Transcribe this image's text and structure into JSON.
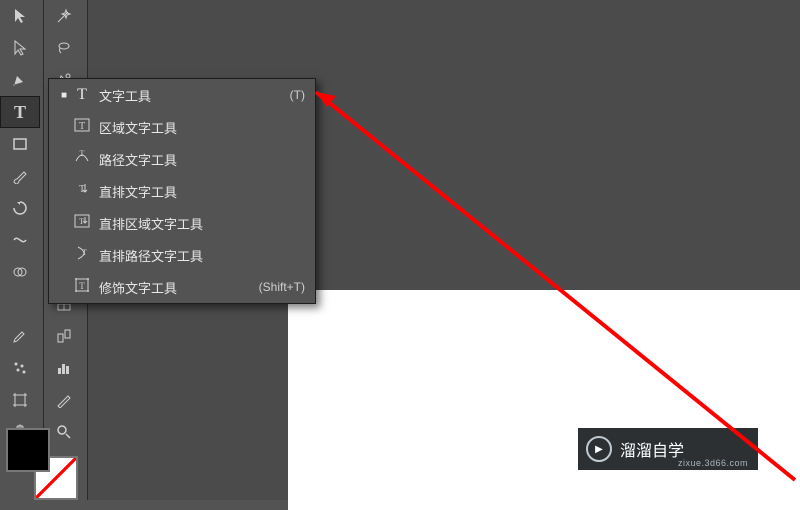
{
  "flyout": {
    "items": [
      {
        "icon": "T",
        "label": "文字工具",
        "shortcut": "(T)",
        "active": true
      },
      {
        "icon": "⌶",
        "label": "区域文字工具",
        "shortcut": ""
      },
      {
        "icon": "✎",
        "label": "路径文字工具",
        "shortcut": ""
      },
      {
        "icon": "↓T",
        "label": "直排文字工具",
        "shortcut": ""
      },
      {
        "icon": "⌶",
        "label": "直排区域文字工具",
        "shortcut": ""
      },
      {
        "icon": "✎",
        "label": "直排路径文字工具",
        "shortcut": ""
      },
      {
        "icon": "T",
        "label": "修饰文字工具",
        "shortcut": "(Shift+T)"
      }
    ]
  },
  "watermark": {
    "text": "溜溜自学",
    "url": "zixue.3d66.com"
  },
  "colors": {
    "fg": "#000000",
    "bg": "#ffffff"
  }
}
